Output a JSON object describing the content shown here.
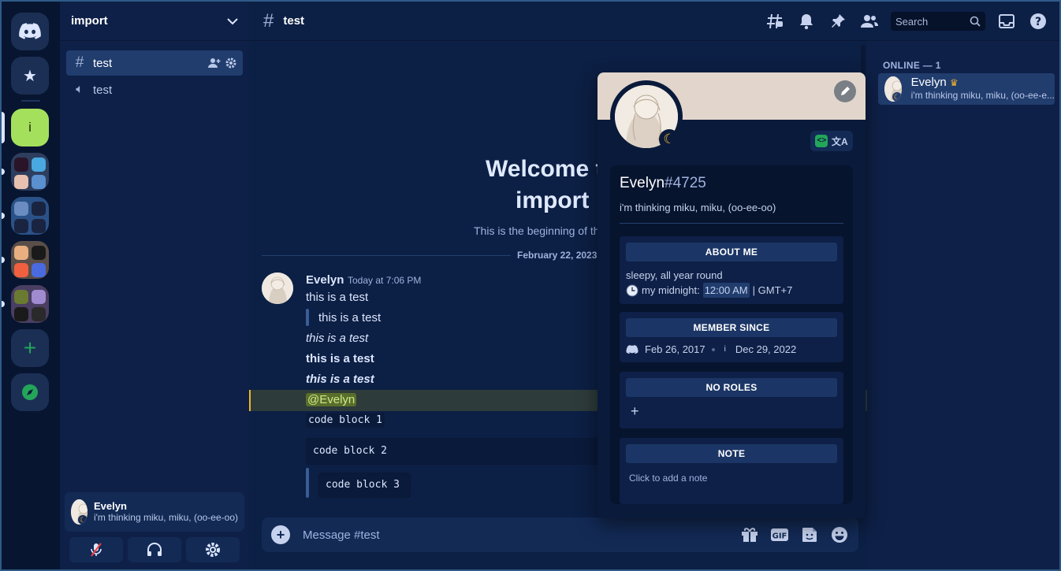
{
  "server": {
    "name": "import",
    "letter_icon": "i"
  },
  "channels": [
    {
      "type": "text",
      "name": "test",
      "active": true
    },
    {
      "type": "voice",
      "name": "test",
      "active": false
    }
  ],
  "user_panel": {
    "name": "Evelyn",
    "status": "i'm thinking miku, miku, (oo-ee-oo)"
  },
  "topbar": {
    "channel_name": "test",
    "search_placeholder": "Search"
  },
  "welcome": {
    "line1": "Welcome to",
    "line2": "import",
    "subtitle": "This is the beginning of this server."
  },
  "date_divider": "February 22, 2023",
  "message": {
    "author": "Evelyn",
    "timestamp": "Today at 7:06 PM",
    "lines": {
      "plain": "this is a test",
      "quote": "this is a test",
      "italic": "this is a test",
      "bold": "this is a test",
      "bold_italic": "this is a test",
      "mention": "@Evelyn",
      "code1": "code block 1",
      "code2": "code block 2",
      "code3": "code block 3"
    }
  },
  "composer": {
    "placeholder": "Message #test"
  },
  "members": {
    "category": "ONLINE — 1",
    "list": [
      {
        "name": "Evelyn",
        "status": "i'm thinking miku, miku, (oo-ee-e..."
      }
    ]
  },
  "profile": {
    "name": "Evelyn",
    "discriminator": "#4725",
    "status": "i'm thinking miku, miku, (oo-ee-oo)",
    "about_header": "ABOUT ME",
    "about_line1": "sleepy, all year round",
    "about_line2_prefix": "my midnight:",
    "about_time": "12:00 AM",
    "about_tz": "| GMT+7",
    "member_since_header": "MEMBER SINCE",
    "discord_since": "Feb 26, 2017",
    "server_since": "Dec 29, 2022",
    "server_letter": "i",
    "roles_header": "NO ROLES",
    "note_header": "NOTE",
    "note_placeholder": "Click to add a note"
  },
  "colors": {
    "accent": "#a5e05d",
    "mention_bar": "#f0b232",
    "idle": "#f0b232",
    "online_green": "#23a55a"
  },
  "icons": [
    "discord-logo-icon",
    "star-icon",
    "plus-icon",
    "compass-icon",
    "hash-icon",
    "speaker-icon",
    "add-member-icon",
    "gear-icon",
    "chevron-down-icon",
    "threads-icon",
    "bell-icon",
    "pin-icon",
    "members-icon",
    "search-icon",
    "inbox-icon",
    "help-icon",
    "gift-icon",
    "gif-icon",
    "sticker-icon",
    "emoji-icon",
    "mic-muted-icon",
    "headphones-icon",
    "pencil-icon",
    "nitro-icon",
    "translate-icon",
    "clock-icon",
    "crown-icon",
    "moon-icon"
  ]
}
